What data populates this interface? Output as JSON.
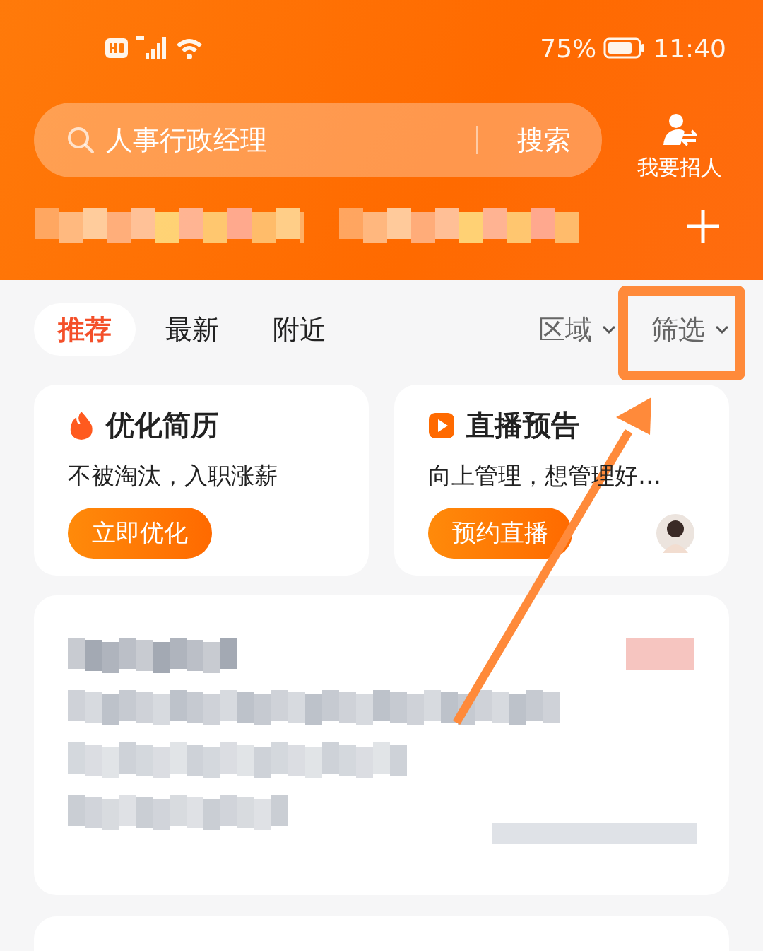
{
  "status_bar": {
    "battery": "75%",
    "time": "11:40"
  },
  "search": {
    "value": "人事行政经理",
    "button": "搜索"
  },
  "recruit": {
    "label": "我要招人"
  },
  "intent_bar": {
    "kind": "redacted"
  },
  "tabs": [
    {
      "label": "推荐",
      "selected": true
    },
    {
      "label": "最新",
      "selected": false
    },
    {
      "label": "附近",
      "selected": false
    }
  ],
  "filters": [
    {
      "label": "区域"
    },
    {
      "label": "筛选"
    }
  ],
  "promo_cards": [
    {
      "kind": "fire",
      "title": "优化简历",
      "subtitle": "不被淘汰，入职涨薪",
      "button": "立即优化"
    },
    {
      "kind": "live",
      "title": "直播预告",
      "subtitle": "向上管理，想管理好…",
      "button": "预约直播"
    }
  ],
  "job_cards": [
    {
      "kind": "redacted"
    },
    {
      "kind": "cut"
    }
  ],
  "annotations": {
    "highlight_box": true,
    "arrow": true
  }
}
